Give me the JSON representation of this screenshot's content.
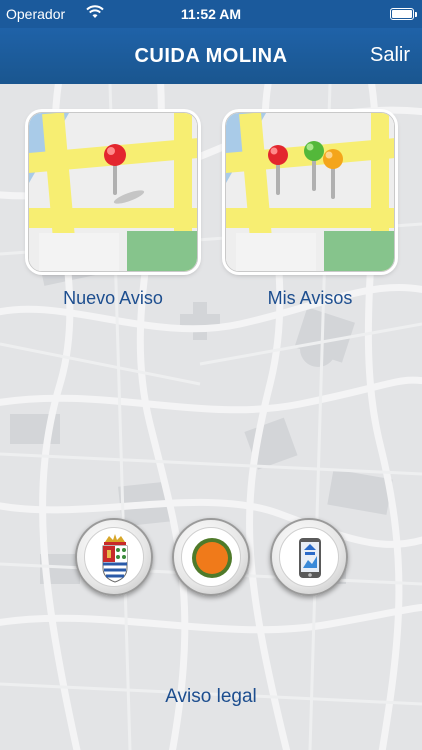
{
  "status_bar": {
    "carrier": "Operador",
    "time": "11:52 AM"
  },
  "nav": {
    "title": "CUIDA MOLINA",
    "exit_label": "Salir"
  },
  "tiles": [
    {
      "label": "Nuevo Aviso",
      "icon": "single-pin-map-icon"
    },
    {
      "label": "Mis Avisos",
      "icon": "multiple-pins-map-icon"
    }
  ],
  "round_buttons": [
    {
      "icon": "town-coat-of-arms-icon"
    },
    {
      "icon": "orange-circle-icon"
    },
    {
      "icon": "mobile-app-icon"
    }
  ],
  "footer": {
    "legal_label": "Aviso legal"
  },
  "colors": {
    "brand_blue": "#1f62a8",
    "link_blue": "#1d4e8f",
    "map_yellow": "#f7ee72",
    "map_green": "#86c48c",
    "map_water": "#a9cbe8",
    "pin_red": "#e3262e",
    "pin_green": "#53b83a",
    "pin_orange": "#f4a51b"
  }
}
